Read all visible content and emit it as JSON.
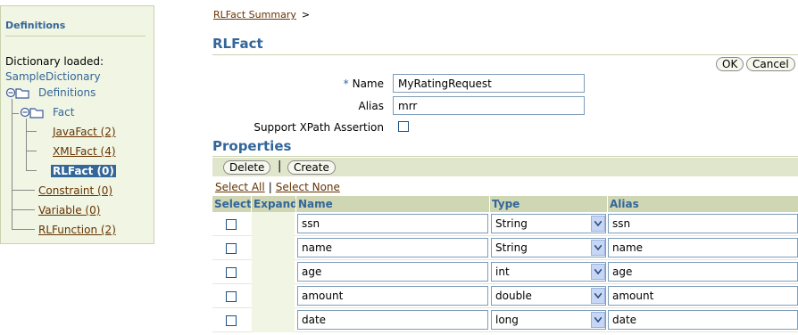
{
  "sidebar": {
    "title": "Definitions",
    "dictionary_label": "Dictionary loaded:",
    "dictionary_name": "SampleDictionary",
    "tree": {
      "definitions": "Definitions",
      "fact": "Fact",
      "javafact": "JavaFact (2)",
      "xmlfact": "XMLFact (4)",
      "rlfact": "RLFact (0)",
      "constraint": "Constraint (0)",
      "variable": "Variable (0)",
      "rlfunction": "RLFunction (2)"
    }
  },
  "breadcrumb": {
    "link": "RLFact Summary",
    "separator": ">"
  },
  "page": {
    "title": "RLFact",
    "ok_label": "OK",
    "cancel_label": "Cancel"
  },
  "form": {
    "required_mark": "*",
    "name_label": "Name",
    "name_value": "MyRatingRequest",
    "alias_label": "Alias",
    "alias_value": "mrr",
    "xpath_label": "Support XPath Assertion"
  },
  "properties": {
    "title": "Properties",
    "delete_label": "Delete",
    "toolbar_separator": "|",
    "create_label": "Create",
    "select_all": "Select All",
    "links_separator": "|",
    "select_none": "Select None",
    "columns": {
      "select": "Select",
      "expand": "Expand",
      "name": "Name",
      "type": "Type",
      "alias": "Alias"
    },
    "rows": [
      {
        "name": "ssn",
        "type": "String",
        "alias": "ssn"
      },
      {
        "name": "name",
        "type": "String",
        "alias": "name"
      },
      {
        "name": "age",
        "type": "int",
        "alias": "age"
      },
      {
        "name": "amount",
        "type": "double",
        "alias": "amount"
      },
      {
        "name": "date",
        "type": "long",
        "alias": "date"
      }
    ]
  }
}
